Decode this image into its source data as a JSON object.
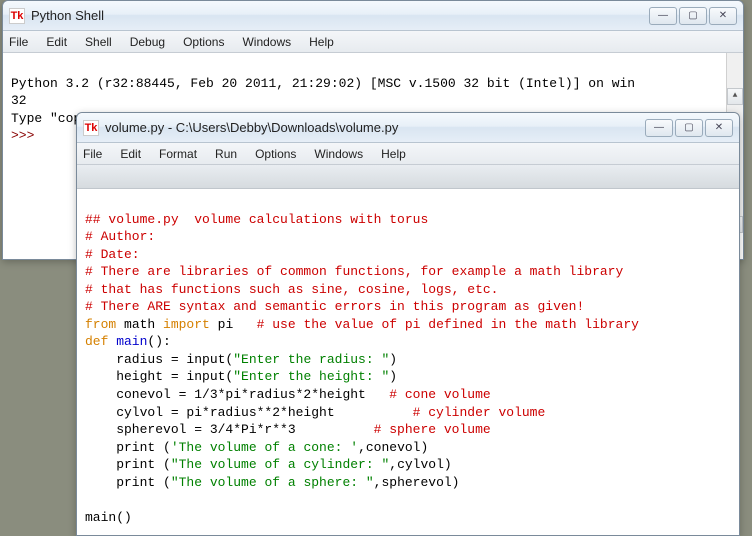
{
  "shell": {
    "title": "Python Shell",
    "menu": {
      "file": "File",
      "edit": "Edit",
      "shell": "Shell",
      "debug": "Debug",
      "options": "Options",
      "windows": "Windows",
      "help": "Help"
    },
    "line1": "Python 3.2 (r32:88445, Feb 20 2011, 21:29:02) [MSC v.1500 32 bit (Intel)] on win",
    "line2": "32",
    "line3": "Type \"copyright\", \"credits\" or \"license()\" for more information.",
    "prompt": ">>> "
  },
  "editor": {
    "title": "volume.py - C:\\Users\\Debby\\Downloads\\volume.py",
    "menu": {
      "file": "File",
      "edit": "Edit",
      "format": "Format",
      "run": "Run",
      "options": "Options",
      "windows": "Windows",
      "help": "Help"
    },
    "code": {
      "l1": "## volume.py  volume calculations with torus",
      "l2": "# Author:",
      "l3": "# Date:",
      "l4": "# There are libraries of common functions, for example a math library",
      "l5": "# that has functions such as sine, cosine, logs, etc.",
      "l6": "# There ARE syntax and semantic errors in this program as given!",
      "l7a": "from",
      "l7b": " math ",
      "l7c": "import",
      "l7d": " pi   ",
      "l7e": "# use the value of pi defined in the math library",
      "l8a": "def",
      "l8b": " main",
      "l8c": "():",
      "l9a": "    radius = input(",
      "l9b": "\"Enter the radius: \"",
      "l9c": ")",
      "l10a": "    height = input(",
      "l10b": "\"Enter the height: \"",
      "l10c": ")",
      "l11a": "    conevol = 1/3*pi*radius*2*height   ",
      "l11b": "# cone volume",
      "l12a": "    cylvol = pi*radius**2*height          ",
      "l12b": "# cylinder volume",
      "l13a": "    spherevol = 3/4*Pi*r**3          ",
      "l13b": "# sphere volume",
      "l14a": "    print",
      "l14b": " (",
      "l14c": "'The volume of a cone: '",
      "l14d": ",conevol)",
      "l15a": "    print",
      "l15b": " (",
      "l15c": "\"The volume of a cylinder: \"",
      "l15d": ",cylvol)",
      "l16a": "    print",
      "l16b": " (",
      "l16c": "\"The volume of a sphere: \"",
      "l16d": ",spherevol)",
      "l17": "",
      "l18": "main()"
    }
  },
  "icons": {
    "tk": "Tk",
    "min": "—",
    "max": "▢",
    "close": "✕",
    "up": "▲",
    "down": "▼"
  }
}
